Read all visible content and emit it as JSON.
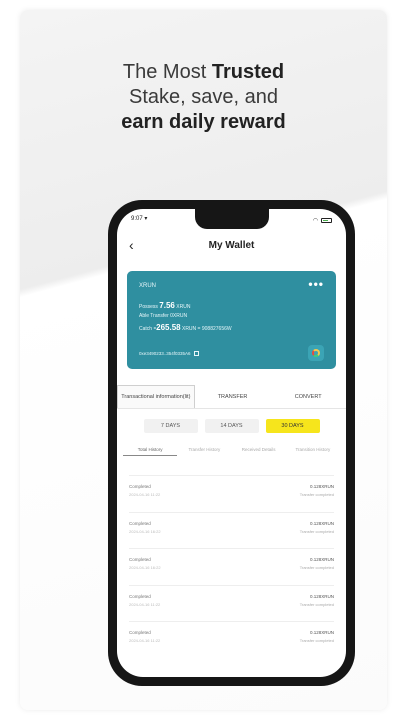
{
  "headline": {
    "line1_normal": "The Most ",
    "line1_bold": "Trusted",
    "line2": "Stake, save, and",
    "line3_bold": "earn daily reward"
  },
  "status_bar": {
    "time": "9:07 ▾"
  },
  "header": {
    "title": "My Wallet",
    "back_icon": "chevron-left-icon"
  },
  "wallet_card": {
    "name": "XRUN",
    "menu": "•••",
    "possess_label": "Possess",
    "possess_value": "7.56",
    "possess_unit": "XRUN",
    "able_transfer": "Able Transfer  0XRUN",
    "catch_label": "Catch",
    "catch_value": "-265.58",
    "catch_unit": "XRUN = 908827656W",
    "address": "0xe3490233..354f0335A6",
    "color": "#2f8fa0"
  },
  "tabs": [
    {
      "label": "Transactional information(lit)",
      "active": true
    },
    {
      "label": "TRANSFER",
      "active": false
    },
    {
      "label": "CONVERT",
      "active": false
    }
  ],
  "day_filters": [
    {
      "label": "7 DAYS",
      "active": false
    },
    {
      "label": "14 DAYS",
      "active": false
    },
    {
      "label": "30 DAYS",
      "active": true
    }
  ],
  "subtabs": [
    {
      "label": "Total History",
      "active": true
    },
    {
      "label": "Transfer History",
      "active": false
    },
    {
      "label": "Received Details",
      "active": false
    },
    {
      "label": "Transition History",
      "active": false
    }
  ],
  "transactions": [
    {
      "status": "Completed",
      "date": "2024-04-16  11:22",
      "amount": "0.128XRUN",
      "note": "Transfer completed"
    },
    {
      "status": "Completed",
      "date": "2024-04-16  16:22",
      "amount": "0.128XRUN",
      "note": "Transfer completed"
    },
    {
      "status": "Completed",
      "date": "2024-04-16  16:22",
      "amount": "0.128XRUN",
      "note": "Transfer completed"
    },
    {
      "status": "Completed",
      "date": "2024-04-16  11:22",
      "amount": "0.128XRUN",
      "note": "Transfer completed"
    },
    {
      "status": "Completed",
      "date": "2024-04-16  11:22",
      "amount": "0.128XRUN",
      "note": "Transfer completed"
    }
  ]
}
